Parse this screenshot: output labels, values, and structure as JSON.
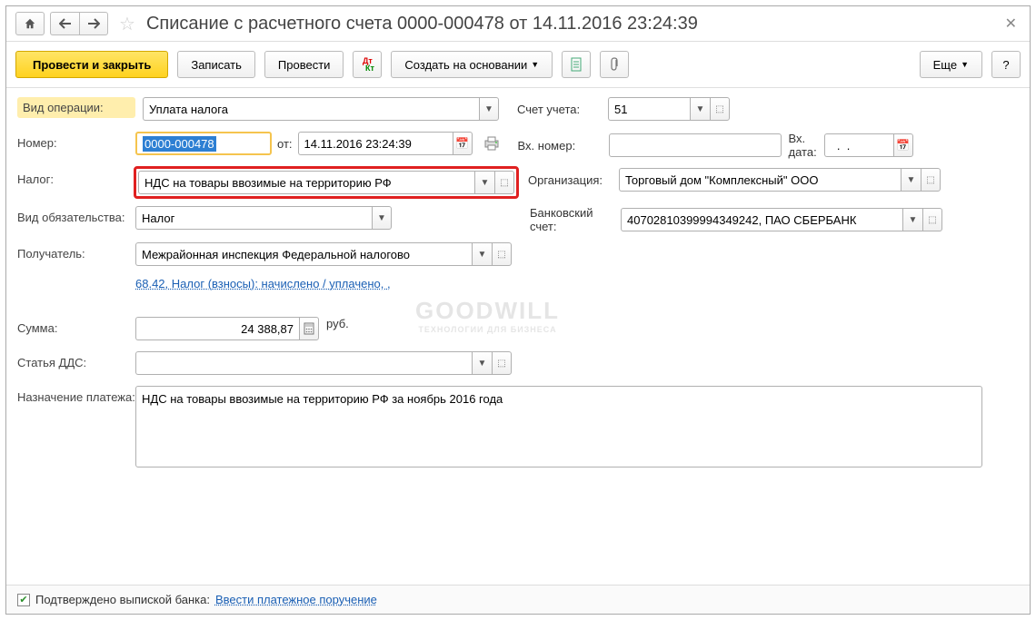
{
  "title": "Списание с расчетного счета 0000-000478 от 14.11.2016 23:24:39",
  "toolbar": {
    "post_and_close": "Провести и закрыть",
    "save": "Записать",
    "post": "Провести",
    "create_based_on": "Создать на основании",
    "more": "Еще"
  },
  "labels": {
    "operation_type": "Вид операции:",
    "account": "Счет учета:",
    "number": "Номер:",
    "from": "от:",
    "in_number": "Вх. номер:",
    "in_date": "Вх. дата:",
    "tax": "Налог:",
    "organization": "Организация:",
    "obligation_type": "Вид обязательства:",
    "bank_account": "Банковский счет:",
    "recipient": "Получатель:",
    "sum": "Сумма:",
    "rub": "руб.",
    "cashflow": "Статья ДДС:",
    "purpose": "Назначение платежа:"
  },
  "values": {
    "operation_type": "Уплата налога",
    "account": "51",
    "number": "0000-000478",
    "date": "14.11.2016 23:24:39",
    "in_number": "",
    "in_date": "  .  .    ",
    "tax": "НДС на товары ввозимые на территорию РФ",
    "organization": "Торговый дом \"Комплексный\" ООО",
    "obligation_type": "Налог",
    "bank_account": "40702810399994349242, ПАО СБЕРБАНК",
    "recipient": "Межрайонная инспекция Федеральной налогово",
    "distribution_link": "68.42, Налог (взносы): начислено / уплачено, ,",
    "sum": "24 388,87",
    "cashflow": "",
    "purpose": "НДС на товары ввозимые на территорию РФ за ноябрь 2016 года"
  },
  "footer": {
    "confirmed": "Подтверждено выпиской банка:",
    "enter_link": "Ввести платежное поручение"
  },
  "watermark": "GOODWILL",
  "watermark_sub": "ТЕХНОЛОГИИ ДЛЯ БИЗНЕСА"
}
